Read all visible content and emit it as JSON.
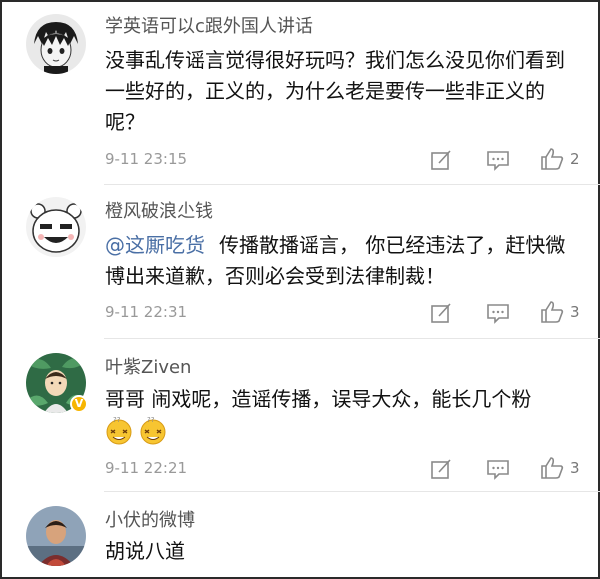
{
  "comments": [
    {
      "username": "学英语可以c跟外国人讲话",
      "text": "没事乱传谣言觉得很好玩吗？我们怎么没见你们看到一些好的，正义的，为什么老是要传一些非正义的呢？",
      "time": "9-11 23:15",
      "likes": "2",
      "avatar_icon": "anime-boy-avatar"
    },
    {
      "username": "橙风破浪尐钱",
      "mention": "@这厮吃货",
      "text": "传播散播谣言， 你已经违法了，赶快微博出来道歉，否则必会受到法律制裁！",
      "time": "9-11 22:31",
      "likes": "3",
      "avatar_icon": "cartoon-face-avatar"
    },
    {
      "username": "叶紫Ziven",
      "text": "哥哥 闹戏呢，造谣传播，误导大众，能长几个粉",
      "emojis": [
        "dizzy-face-emoji",
        "dizzy-face-emoji"
      ],
      "time": "9-11 22:21",
      "likes": "3",
      "avatar_icon": "leaf-avatar",
      "verified_badge": "V"
    },
    {
      "username": "小伏的微博",
      "text": "胡说八道",
      "avatar_icon": "photo-avatar"
    }
  ],
  "colors": {
    "mention": "#4a6fa5",
    "badge": "#f7b500",
    "username": "#555555",
    "time": "#999999"
  }
}
